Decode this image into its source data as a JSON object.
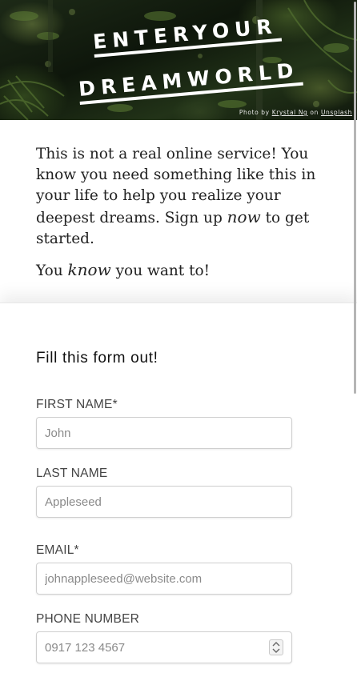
{
  "hero": {
    "title_line1": "ENTERYOUR",
    "title_line2": "DREAMWORLD",
    "credit": {
      "prefix": "Photo by",
      "author": "Krystal Ng",
      "joiner": "on",
      "source": "Unsplash"
    }
  },
  "intro": {
    "p1_before": "This is not a real online service! You know you need something like this in your life to help you realize your deepest dreams. Sign up ",
    "p1_emphasis": "now",
    "p1_after": " to get started.",
    "p2_before": "You ",
    "p2_emphasis": "know",
    "p2_after": " you want to!"
  },
  "form": {
    "heading": "Fill this form out!",
    "fields": {
      "first_name": {
        "label": "FIRST NAME*",
        "placeholder": "John",
        "value": ""
      },
      "last_name": {
        "label": "LAST NAME",
        "placeholder": "Appleseed",
        "value": ""
      },
      "email": {
        "label": "EMAIL*",
        "placeholder": "johnappleseed@website.com",
        "value": ""
      },
      "phone": {
        "label": "PHONE NUMBER",
        "placeholder": "0917 123 4567",
        "value": ""
      }
    }
  },
  "icons": {
    "spinner": "spinner-arrows-icon"
  }
}
